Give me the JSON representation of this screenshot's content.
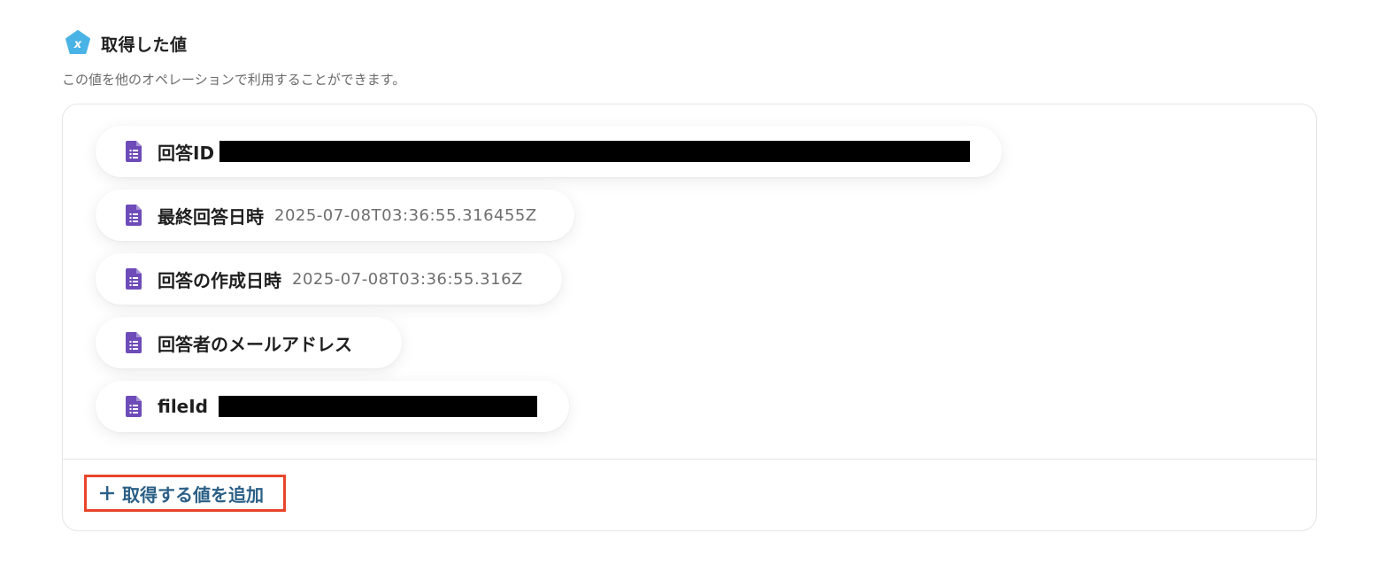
{
  "section": {
    "title": "取得した値",
    "description": "この値を他のオペレーションで利用することができます。",
    "badge_icon": "variable-x-icon",
    "badge_color": "#4ab3e6"
  },
  "values": [
    {
      "label": "回答ID",
      "value": "",
      "redacted": true
    },
    {
      "label": "最終回答日時",
      "value": "2025-07-08T03:36:55.316455Z",
      "redacted": false
    },
    {
      "label": "回答の作成日時",
      "value": "2025-07-08T03:36:55.316Z",
      "redacted": false
    },
    {
      "label": "回答者のメールアドレス",
      "value": "",
      "redacted": false
    },
    {
      "label": "fileId",
      "value": "",
      "redacted": true
    }
  ],
  "item_icon": "google-forms-icon",
  "item_icon_color": "#6e4bb8",
  "add_button": {
    "label": "取得する値を追加",
    "icon": "plus-icon",
    "color": "#2b5f86",
    "highlight_color": "#e8452c"
  }
}
